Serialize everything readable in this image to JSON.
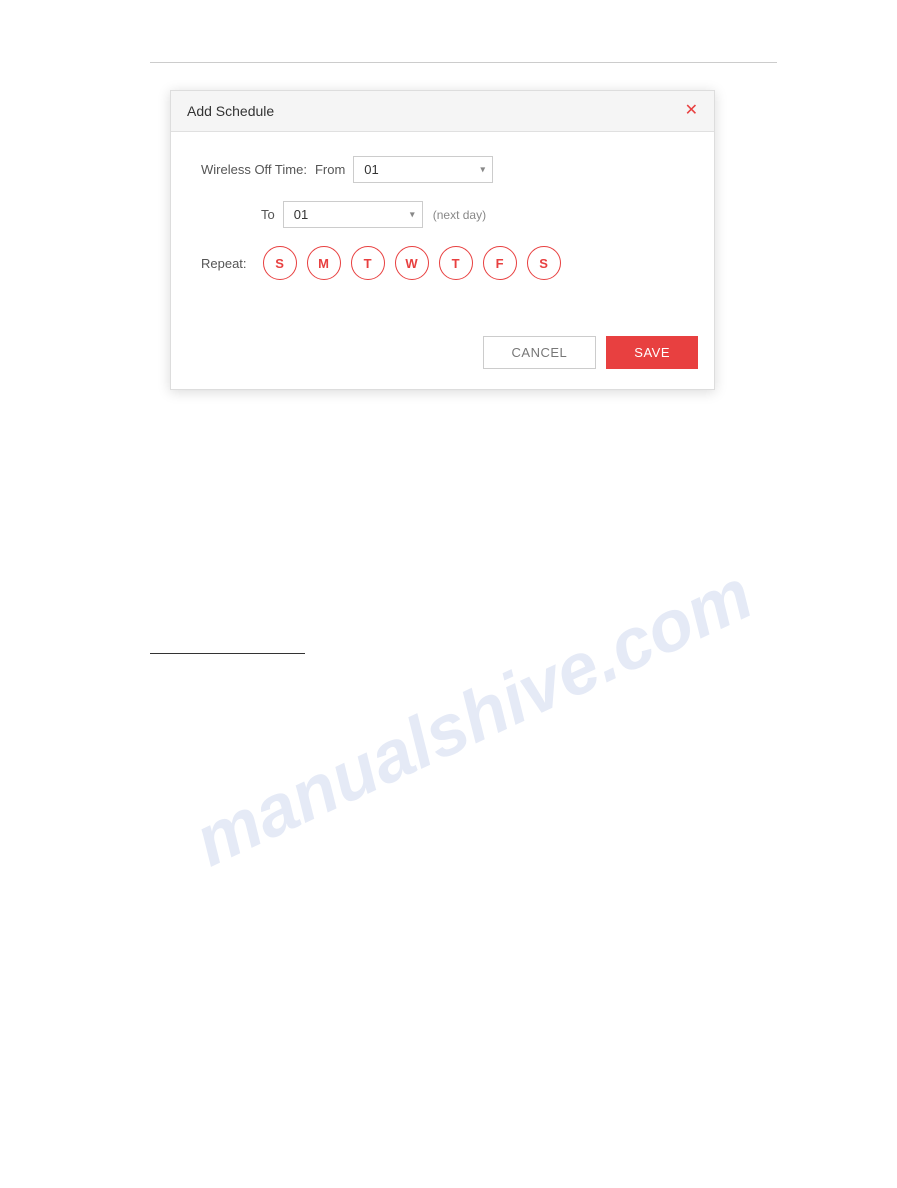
{
  "page": {
    "background": "#ffffff"
  },
  "watermark": {
    "text": "manualshive.com"
  },
  "modal": {
    "title": "Add Schedule",
    "close_icon": "×",
    "wireless_off_time_label": "Wireless Off Time:",
    "from_label": "From",
    "to_label": "To",
    "from_value": "01",
    "to_value": "01",
    "next_day_label": "(next day)",
    "repeat_label": "Repeat:",
    "days": [
      {
        "letter": "S",
        "active": false,
        "name": "Sunday"
      },
      {
        "letter": "M",
        "active": false,
        "name": "Monday"
      },
      {
        "letter": "T",
        "active": false,
        "name": "Tuesday"
      },
      {
        "letter": "W",
        "active": false,
        "name": "Wednesday"
      },
      {
        "letter": "T",
        "active": false,
        "name": "Thursday"
      },
      {
        "letter": "F",
        "active": false,
        "name": "Friday"
      },
      {
        "letter": "S",
        "active": false,
        "name": "Saturday"
      }
    ],
    "cancel_label": "CANCEL",
    "save_label": "SAVE",
    "accent_color": "#e84040"
  }
}
